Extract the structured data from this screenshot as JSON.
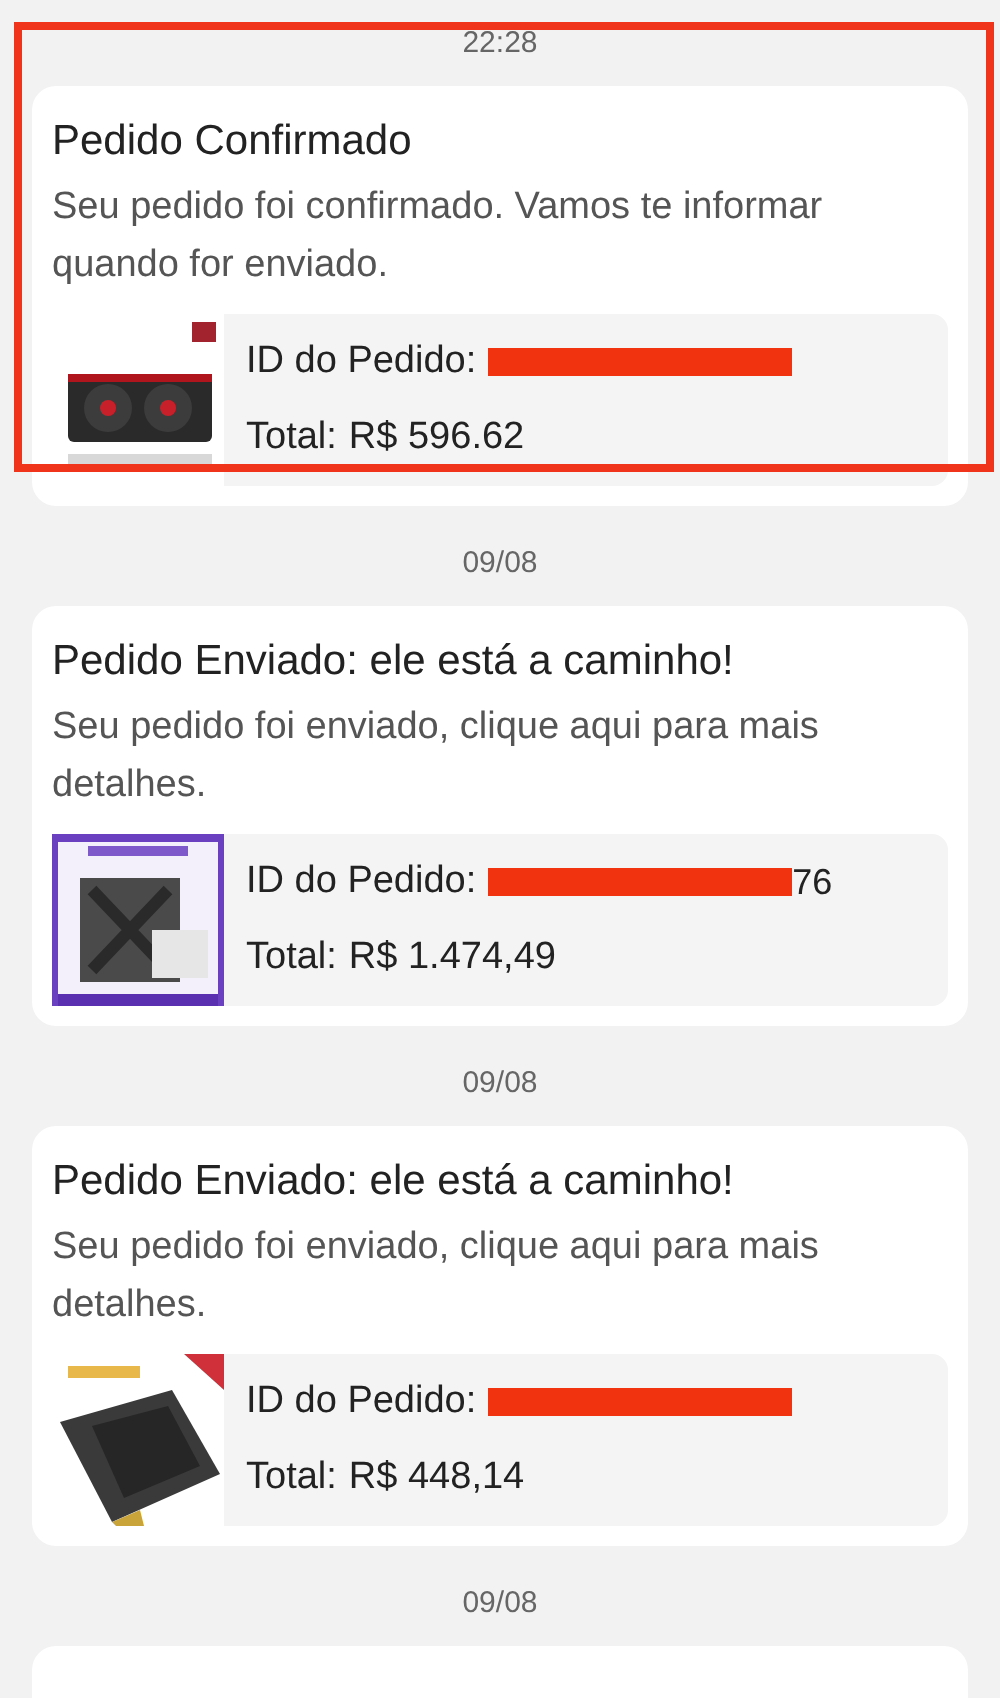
{
  "notifications": [
    {
      "time": "22:28",
      "title": "Pedido Confirmado",
      "message": "Seu pedido foi confirmado. Vamos te informar quando for enviado.",
      "highlighted": true,
      "order_id_label": "ID do Pedido:",
      "order_id_redacted": true,
      "total_label": "Total:",
      "total": "R$ 596.62"
    },
    {
      "time": "09/08",
      "title": "Pedido Enviado: ele está a caminho!",
      "message": "Seu pedido foi enviado, clique aqui para mais detalhes.",
      "highlighted": false,
      "order_id_label": "ID do Pedido:",
      "order_id_redacted": true,
      "order_id_tail": "76",
      "total_label": "Total:",
      "total": "R$ 1.474,49"
    },
    {
      "time": "09/08",
      "title": "Pedido Enviado: ele está a caminho!",
      "message": "Seu pedido foi enviado, clique aqui para mais detalhes.",
      "highlighted": false,
      "order_id_label": "ID do Pedido:",
      "order_id_redacted": true,
      "total_label": "Total:",
      "total": "R$ 448,14"
    },
    {
      "time": "09/08",
      "highlighted": false
    }
  ]
}
